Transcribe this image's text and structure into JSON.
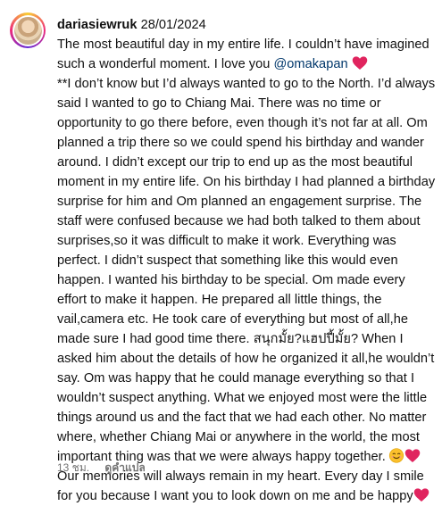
{
  "comment": {
    "username": "dariasiewruk",
    "date": "28/01/2024",
    "text_1": "The most beautiful day in my entire life. I couldn’t have imagined such a wonderful moment. I love you ",
    "mention": "@omakapan",
    "text_2": "\n**I don’t know but I’d always wanted to go to the North. I’d always said I wanted to go to Chiang Mai. There was no time or opportunity to go there before, even though it’s not far at all. Om planned a trip there so we could spend his birthday and wander around. I didn’t except our trip to end up as the most beautiful moment in my entire life. On his birthday I had planned a birthday surprise for him and Om planned an engagement surprise. The staff were confused because we had both talked to them about surprises,so it was difficult to make it work. Everything was perfect. I didn’t suspect that something like this would even happen. I wanted his birthday to be special. Om made every effort to make it happen. He prepared all little things, the vail,camera etc. He took care of everything but most of all,he made sure I had good time there. สนุกมั้ย?แฮปปี้มั้ย? When I asked him about the details of how he organized it all,he wouldn’t say. Om was happy that he could manage everything so that I wouldn’t suspect anything. What we enjoyed most were the little things around us and the fact that we had each other. No matter where, whether Chiang Mai or anywhere in the world, the most important thing was that we were always happy together.",
    "text_3": "Our memories will always remain in my heart. Every day I smile for you because I want you to look down on me and be happy"
  },
  "footer": {
    "time_ago": "13 ชม.",
    "translate_label": "ดูคำแปล"
  },
  "icons": [
    "red-heart-emoji",
    "smiling-face-emoji"
  ],
  "colors": {
    "mention": "#00376b",
    "heart": "#e0245e",
    "meta_text": "#737373"
  }
}
